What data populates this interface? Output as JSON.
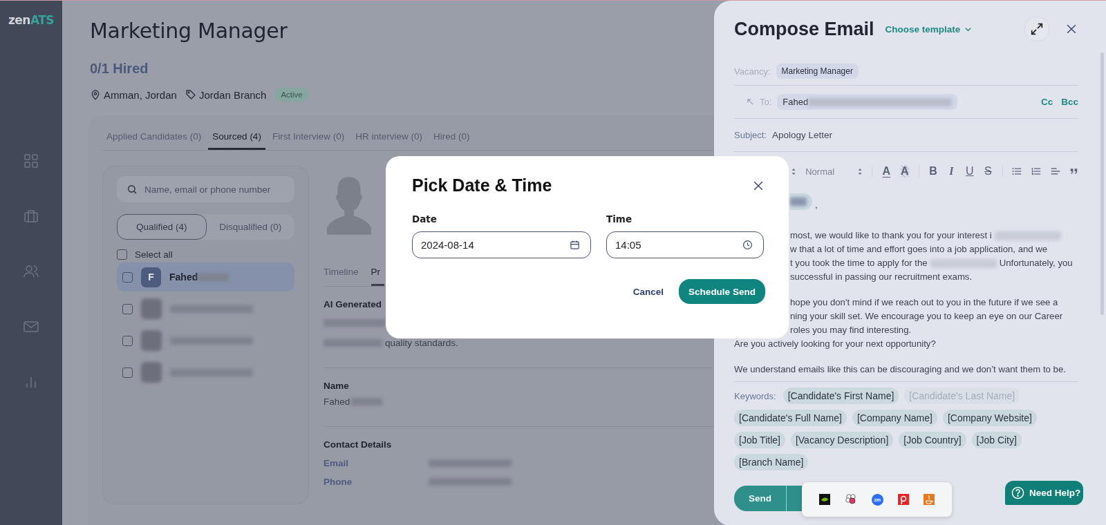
{
  "sidebar": {
    "logo": {
      "main": "zen",
      "accent": "ATS"
    },
    "items": [
      {
        "kind": "grid",
        "selected": false
      },
      {
        "kind": "briefcase",
        "selected": false
      },
      {
        "kind": "users",
        "selected": false
      },
      {
        "kind": "mail",
        "selected": false
      },
      {
        "kind": "chart",
        "selected": false
      }
    ]
  },
  "job": {
    "title": "Marketing Manager",
    "hired": "0/1 Hired",
    "location": "Amman, Jordan",
    "branch": "Jordan Branch",
    "status": "Active"
  },
  "tabs": [
    {
      "label": "Applied Candidates (0)",
      "selected": false
    },
    {
      "label": "Sourced (4)",
      "selected": true
    },
    {
      "label": "First Interview (0)",
      "selected": false
    },
    {
      "label": "HR interview (0)",
      "selected": false
    },
    {
      "label": "Hired (0)",
      "selected": false
    }
  ],
  "candidates": {
    "search": {
      "placeholder": "Name, email or phone number"
    },
    "filters": [
      {
        "label": "Qualified (4)",
        "selected": true
      },
      {
        "label": "Disqualified (0)",
        "selected": false
      }
    ],
    "select_all": {
      "label": "Select all",
      "checked": false
    },
    "rows": [
      {
        "kind": "initial",
        "initial": "F",
        "name": "Fahed",
        "selected": true,
        "checked": false
      },
      {
        "kind": "blurred",
        "selected": false,
        "checked": false
      },
      {
        "kind": "blurred",
        "selected": false,
        "checked": false
      },
      {
        "kind": "blurred",
        "selected": false,
        "checked": false
      }
    ]
  },
  "profile": {
    "tabs": [
      {
        "label": "Timeline",
        "selected": false
      },
      {
        "label": "Pr",
        "selected": true
      }
    ],
    "ai_heading": "AI Generated",
    "ai_text": "quality standards.",
    "name_label": "Name",
    "name_value": "Fahed",
    "contact_heading": "Contact Details",
    "contacts": [
      {
        "label": "Email"
      },
      {
        "label": "Phone"
      }
    ]
  },
  "compose": {
    "title": "Compose Email",
    "template": "Choose template",
    "vacancy_label": "Vacancy:",
    "vacancy": "Marketing Manager",
    "to_label": "To:",
    "to": "Fahed",
    "cc": "Cc",
    "bcc": "Bcc",
    "subject_label": "Subject:",
    "subject": "Apology Letter",
    "toolbar": [
      {
        "kind": "stepper"
      },
      {
        "kind": "select",
        "text": "Normal"
      },
      {
        "kind": "stepper"
      },
      {
        "kind": "sep"
      },
      {
        "kind": "color",
        "text": "A"
      },
      {
        "kind": "highlight",
        "text": "A"
      },
      {
        "kind": "sep"
      },
      {
        "kind": "bold",
        "text": "B"
      },
      {
        "kind": "italic",
        "text": "I"
      },
      {
        "kind": "underline",
        "text": "U"
      },
      {
        "kind": "strike",
        "text": "S"
      },
      {
        "kind": "sep"
      },
      {
        "kind": "bullets"
      },
      {
        "kind": "numbers"
      },
      {
        "kind": "align"
      },
      {
        "kind": "quote"
      }
    ],
    "body": [
      {
        "partial": true,
        "paragraph_start": false,
        "parts": [
          {
            "kind": "chip"
          },
          {
            "kind": "text",
            "text": ","
          }
        ]
      },
      {
        "partial": true,
        "paragraph_start": true,
        "parts": [
          {
            "kind": "text",
            "text": "most, we would like to thank you for your interest i"
          },
          {
            "kind": "blur"
          }
        ]
      },
      {
        "partial": true,
        "paragraph_start": false,
        "parts": [
          {
            "kind": "text",
            "text": "w that a lot of time and effort goes into a job application, and we"
          }
        ]
      },
      {
        "partial": true,
        "paragraph_start": false,
        "parts": [
          {
            "kind": "text",
            "text": "t you took the time to apply for the"
          },
          {
            "kind": "blur"
          },
          {
            "kind": "text",
            "text": "Unfortunately, you"
          }
        ]
      },
      {
        "partial": true,
        "paragraph_start": false,
        "parts": [
          {
            "kind": "text",
            "text": "successful in passing our recruitment exams."
          }
        ]
      },
      {
        "partial": true,
        "paragraph_start": true,
        "parts": [
          {
            "kind": "text",
            "text": "hope you don't mind if we reach out to you in the future if we see a"
          }
        ]
      },
      {
        "partial": true,
        "paragraph_start": false,
        "parts": [
          {
            "kind": "text",
            "text": "ning your skill set. We encourage you to keep an eye on our  Career"
          }
        ]
      },
      {
        "partial": true,
        "paragraph_start": false,
        "parts": [
          {
            "kind": "text",
            "text": "roles you may find interesting."
          }
        ]
      },
      {
        "partial": false,
        "paragraph_start": false,
        "parts": [
          {
            "kind": "text",
            "text": "Are you actively looking for your next opportunity?"
          }
        ]
      },
      {
        "partial": false,
        "paragraph_start": true,
        "parts": [
          {
            "kind": "text",
            "text": "We understand emails like this can be discouraging and we don’t want them to be."
          }
        ]
      }
    ],
    "keywords_label": "Keywords:",
    "keywords": [
      {
        "label": "[Candidate's First Name]",
        "disabled": false
      },
      {
        "label": "[Candidate's Last Name]",
        "disabled": true
      },
      {
        "label": "[Candidate's Full Name]",
        "disabled": false
      },
      {
        "label": "[Company Name]",
        "disabled": false
      },
      {
        "label": "[Company Website]",
        "disabled": false
      },
      {
        "label": "[Job Title]",
        "disabled": false
      },
      {
        "label": "[Vacancy Description]",
        "disabled": false
      },
      {
        "label": "[Job Country]",
        "disabled": false
      },
      {
        "label": "[Job City]",
        "disabled": false
      },
      {
        "label": "[Branch Name]",
        "disabled": false
      }
    ],
    "send": "Send"
  },
  "modal": {
    "title": "Pick Date & Time",
    "date_label": "Date",
    "date": "2024-08-14",
    "time_label": "Time",
    "time": "14:05",
    "cancel": "Cancel",
    "confirm": "Schedule Send"
  },
  "tray": [
    {
      "kind": "nvidia"
    },
    {
      "kind": "flower"
    },
    {
      "kind": "meeting",
      "text": "zm"
    },
    {
      "kind": "recorder"
    },
    {
      "kind": "java"
    }
  ],
  "help": {
    "label": "Need Help?"
  }
}
